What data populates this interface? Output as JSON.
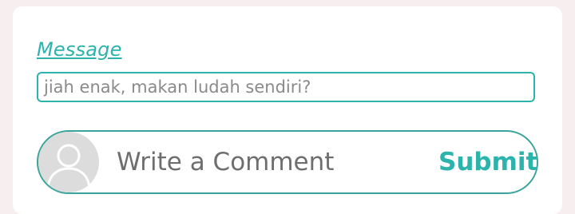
{
  "form": {
    "message_label": "Message",
    "message_text": "jiah enak, makan ludah sendiri?"
  },
  "comment": {
    "placeholder": "Write a Comment",
    "submit_label": "Submit",
    "avatar_icon": "user-icon"
  },
  "colors": {
    "accent": "#2bb3ac",
    "border": "#3aa39a",
    "avatar_bg": "#dcdcdc"
  }
}
